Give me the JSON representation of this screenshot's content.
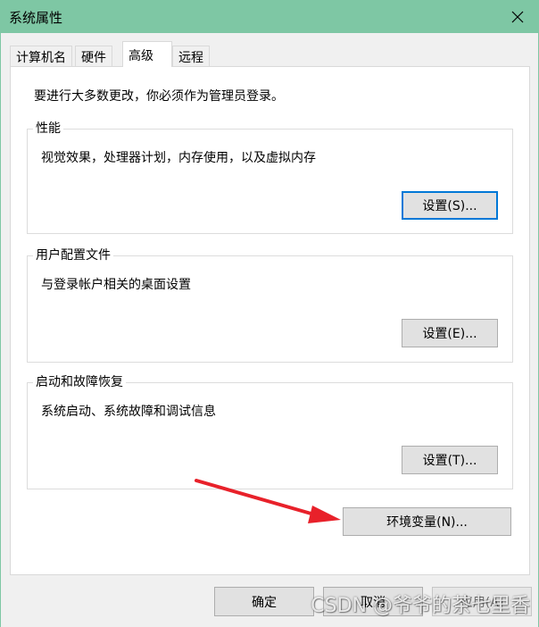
{
  "window": {
    "title": "系统属性",
    "close_icon": "close-icon"
  },
  "tabs": [
    {
      "label": "计算机名",
      "active": false
    },
    {
      "label": "硬件",
      "active": false
    },
    {
      "label": "高级",
      "active": true
    },
    {
      "label": "远程",
      "active": false
    }
  ],
  "admin_note": "要进行大多数更改，你必须作为管理员登录。",
  "groups": {
    "performance": {
      "title": "性能",
      "description": "视觉效果，处理器计划，内存使用，以及虚拟内存",
      "button": "设置(S)..."
    },
    "user_profiles": {
      "title": "用户配置文件",
      "description": "与登录帐户相关的桌面设置",
      "button": "设置(E)..."
    },
    "startup_recovery": {
      "title": "启动和故障恢复",
      "description": "系统启动、系统故障和调试信息",
      "button": "设置(T)..."
    }
  },
  "env_button": "环境变量(N)...",
  "footer": {
    "ok": "确定",
    "cancel": "取消",
    "apply": "应用(A)"
  },
  "watermark": "CSDN @爷爷的茶七里香",
  "colors": {
    "titlebar": "#7ec7a4",
    "focus_border": "#0078d7",
    "annotation_arrow": "#e8212a"
  }
}
